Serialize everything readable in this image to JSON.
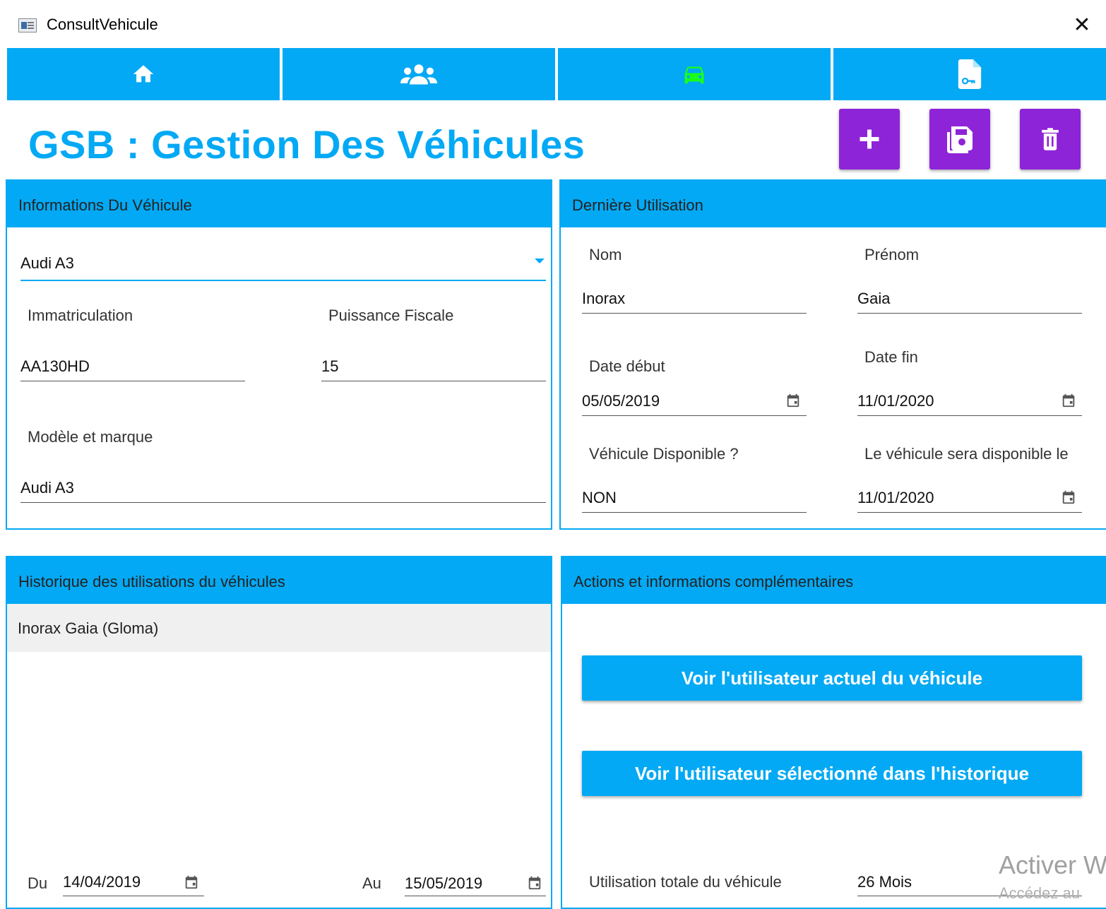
{
  "window": {
    "title": "ConsultVehicule",
    "close_glyph": "✕"
  },
  "nav": {
    "tabs": [
      {
        "icon": "home-icon",
        "active": false
      },
      {
        "icon": "users-icon",
        "active": false
      },
      {
        "icon": "car-icon",
        "active": true
      },
      {
        "icon": "document-key-icon",
        "active": false
      }
    ],
    "active_color": "#1aff1a",
    "color": "#03a9f4"
  },
  "header": {
    "title": "GSB : Gestion Des Véhicules",
    "actions": [
      "add-icon",
      "save-icon",
      "delete-icon"
    ],
    "action_color": "#8e24d8"
  },
  "vehicle_info": {
    "heading": "Informations Du Véhicule",
    "selected_vehicle": "Audi A3",
    "immatriculation_label": "Immatriculation",
    "immatriculation": "AA130HD",
    "puissance_label": "Puissance Fiscale",
    "puissance": "15",
    "modele_label": "Modèle et marque",
    "modele": "Audi A3"
  },
  "last_use": {
    "heading": "Dernière Utilisation",
    "nom_label": "Nom",
    "nom": "Inorax",
    "prenom_label": "Prénom",
    "prenom": "Gaia",
    "date_debut_label": "Date début",
    "date_debut": "05/05/2019",
    "date_fin_label": "Date fin",
    "date_fin": "11/01/2020",
    "disponible_label": "Véhicule Disponible ?",
    "disponible": "NON",
    "disponible_le_label": "Le véhicule sera disponible le",
    "disponible_le": "11/01/2020"
  },
  "history": {
    "heading": "Historique des utilisations du véhicules",
    "items": [
      "Inorax Gaia (Gloma)"
    ],
    "du_label": "Du",
    "du": "14/04/2019",
    "au_label": "Au",
    "au": "15/05/2019"
  },
  "actions": {
    "heading": "Actions et informations complémentaires",
    "btn_current_user": "Voir l'utilisateur actuel du véhicule",
    "btn_selected_user": "Voir l'utilisateur sélectionné dans l'historique",
    "total_label": "Utilisation totale du véhicule",
    "total": "26 Mois"
  },
  "watermark": {
    "line1": "Activer W",
    "line2": "Accédez au"
  },
  "accent_color": "#03a9f4"
}
